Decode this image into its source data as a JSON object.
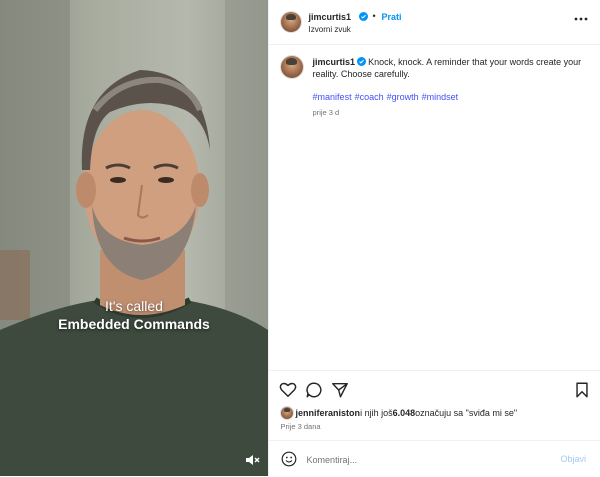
{
  "media": {
    "caption_line1": "It's called",
    "caption_line2": "Embedded Commands",
    "mute_icon": "speaker-muted-icon"
  },
  "header": {
    "username": "jimcurtis1",
    "verified_icon": "verified-badge-icon",
    "separator": "•",
    "follow_label": "Prati",
    "audio_label": "Izvorni zvuk",
    "more_icon": "more-horizontal-icon"
  },
  "caption": {
    "username": "jimcurtis1",
    "text": "Knock, knock. A reminder that your words create your reality. Choose carefully.",
    "hashtags": [
      "#manifest",
      "#coach",
      "#growth",
      "#mindset"
    ],
    "time": "prije 3 d"
  },
  "actions": {
    "like_icon": "heart-icon",
    "comment_icon": "comment-icon",
    "share_icon": "send-icon",
    "save_icon": "bookmark-icon"
  },
  "likes": {
    "user": "jenniferaniston",
    "middle": " i njih još ",
    "count": "6.048",
    "suffix": " označuju sa \"sviđa mi se\""
  },
  "post_time": "Prije 3 dana",
  "composer": {
    "placeholder": "Komentiraj...",
    "post_label": "Objavi",
    "emoji_icon": "emoji-icon"
  },
  "colors": {
    "accent": "#0095f6",
    "hashtag": "#4150f7",
    "post_button_disabled": "#a3c9f3",
    "muted_text": "#737373"
  }
}
